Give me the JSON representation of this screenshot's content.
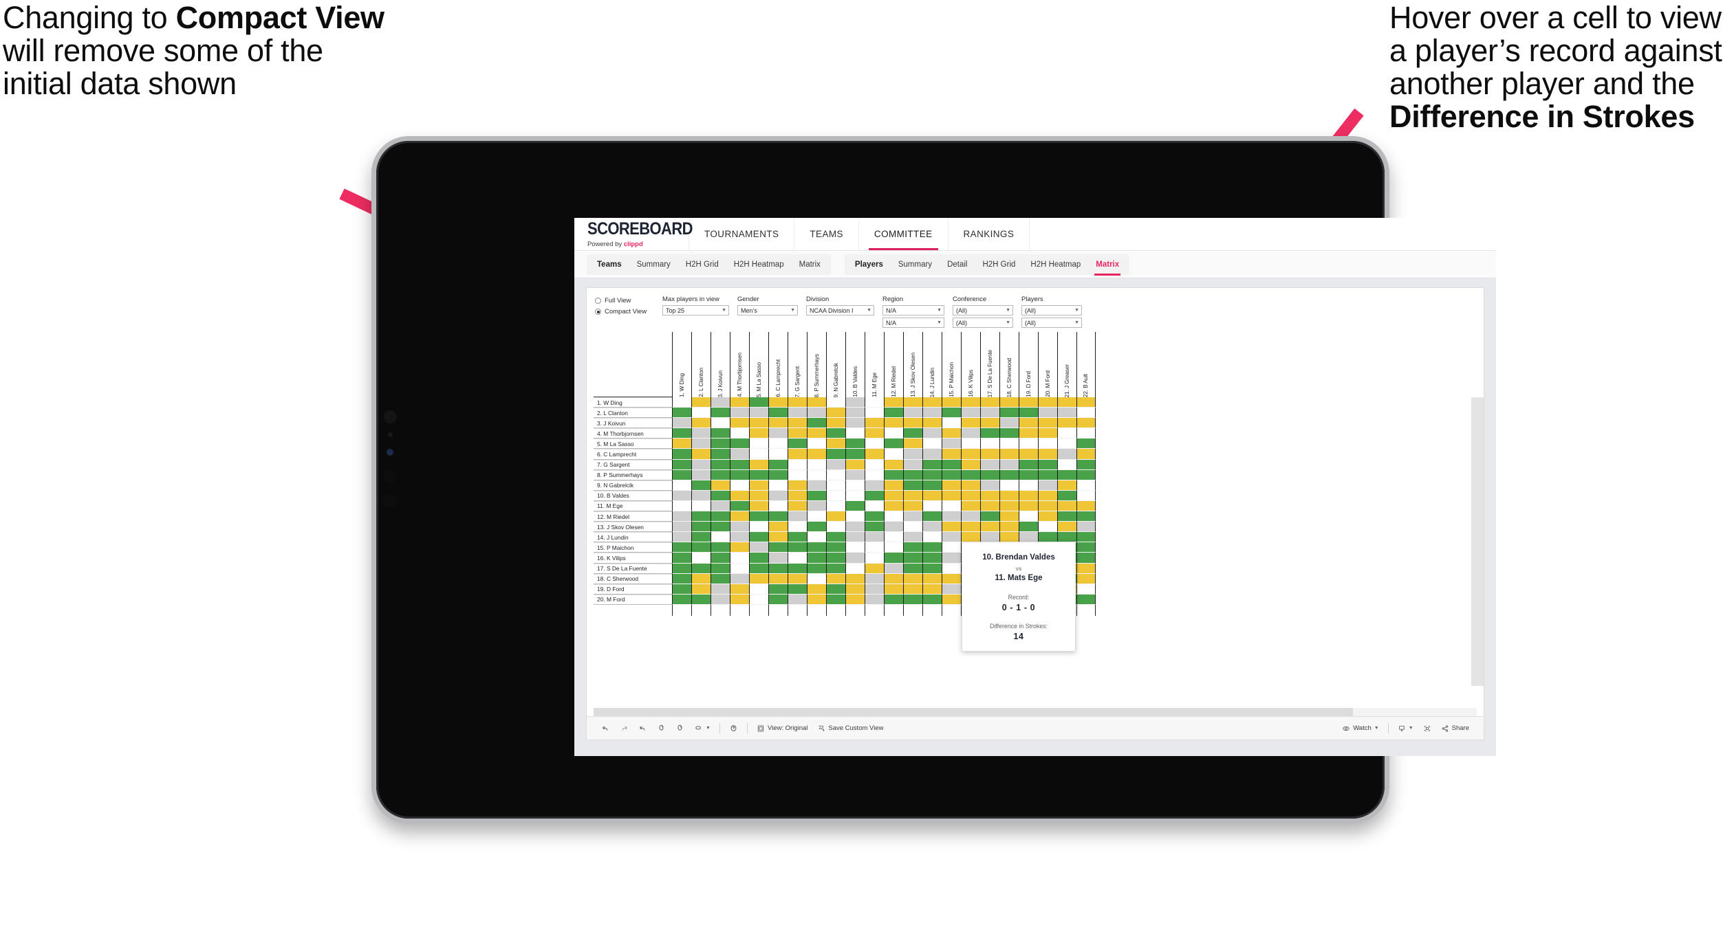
{
  "annotations": {
    "left": {
      "line1": "Changing to ",
      "bold1": "Compact View",
      "line2": " will remove some of the initial data shown"
    },
    "right": {
      "line1": "Hover over a cell to view a player’s record against another player and the ",
      "bold1": "Difference in Strokes"
    }
  },
  "app": {
    "brand": {
      "title": "SCOREBOARD",
      "powered_prefix": "Powered by ",
      "powered_name": "clippd"
    },
    "topnav": [
      {
        "label": "TOURNAMENTS",
        "active": false
      },
      {
        "label": "TEAMS",
        "active": false
      },
      {
        "label": "COMMITTEE",
        "active": true
      },
      {
        "label": "RANKINGS",
        "active": false
      }
    ],
    "subnav": {
      "group_teams": [
        "Teams",
        "Summary",
        "H2H Grid",
        "H2H Heatmap",
        "Matrix"
      ],
      "group_players": [
        "Players",
        "Summary",
        "Detail",
        "H2H Grid",
        "H2H Heatmap",
        "Matrix"
      ],
      "selected": "Matrix"
    },
    "filters": {
      "view_mode": {
        "full": "Full View",
        "compact": "Compact View",
        "selected": "Compact View"
      },
      "fields": [
        {
          "label": "Max players in view",
          "value": "Top 25"
        },
        {
          "label": "Gender",
          "value": "Men’s"
        },
        {
          "label": "Division",
          "value": "NCAA Division I"
        },
        {
          "label": "Region",
          "value": "N/A",
          "value2": "N/A"
        },
        {
          "label": "Conference",
          "value": "(All)",
          "value2": "(All)"
        },
        {
          "label": "Players",
          "value": "(All)",
          "value2": "(All)"
        }
      ]
    },
    "tooltip": {
      "player_a": "10. Brendan Valdes",
      "vs": "vs",
      "player_b": "11. Mats Ege",
      "record_label": "Record:",
      "record_value": "0 - 1 - 0",
      "strokes_label": "Difference in Strokes:",
      "strokes_value": "14"
    },
    "toolbar": {
      "view_label": "View: Original",
      "save_label": "Save Custom View",
      "watch_label": "Watch",
      "share_label": "Share"
    }
  },
  "chart_data": {
    "type": "heatmap",
    "title": "Player Head-to-Head Matrix",
    "legend": {
      "win": "#49a14a",
      "tie": "#eec636",
      "loss": "#cfcfcf",
      "none": "#ffffff"
    },
    "row_labels": [
      "1. W Ding",
      "2. L Clanton",
      "3. J Koivun",
      "4. M Thorbjornsen",
      "5. M La Sasso",
      "6. C Lamprecht",
      "7. G Sargent",
      "8. P Summerhays",
      "9. N Gabrelcik",
      "10. B Valdes",
      "11. M Ege",
      "12. M Riedel",
      "13. J Skov Olesen",
      "14. J Lundin",
      "15. P Maichon",
      "16. K Vilips",
      "17. S De La Fuente",
      "18. C Sherwood",
      "19. D Ford",
      "20. M Ford"
    ],
    "col_labels": [
      "1. W Ding",
      "2. L Clanton",
      "3. J Koivun",
      "4. M Thorbjornsen",
      "5. M La Sasso",
      "6. C Lamprecht",
      "7. G Sargent",
      "8. P Summerhays",
      "9. N Gabrelcik",
      "10. B Valdes",
      "11. M Ege",
      "12. M Riedel",
      "13. J Skov Olesen",
      "14. J Lundin",
      "15. P Maichon",
      "16. K Vilips",
      "17. S De La Fuente",
      "18. C Sherwood",
      "19. D Ford",
      "20. M Ford",
      "21. J Greaser",
      "22. B Ault"
    ],
    "cells": [
      [
        "w",
        "y",
        "a",
        "y",
        "g",
        "y",
        "y",
        "y",
        "w",
        "a",
        "w",
        "y",
        "y",
        "y",
        "y",
        "y",
        "y",
        "y",
        "y",
        "y",
        "y",
        "y"
      ],
      [
        "g",
        "w",
        "g",
        "a",
        "a",
        "g",
        "a",
        "a",
        "y",
        "a",
        "w",
        "g",
        "a",
        "a",
        "g",
        "a",
        "a",
        "g",
        "g",
        "a",
        "a",
        "w"
      ],
      [
        "a",
        "y",
        "w",
        "y",
        "y",
        "y",
        "y",
        "g",
        "y",
        "a",
        "y",
        "y",
        "y",
        "y",
        "w",
        "y",
        "y",
        "a",
        "y",
        "y",
        "y",
        "y"
      ],
      [
        "g",
        "a",
        "g",
        "w",
        "y",
        "a",
        "y",
        "y",
        "g",
        "w",
        "y",
        "w",
        "g",
        "a",
        "y",
        "a",
        "g",
        "g",
        "y",
        "y",
        "w",
        "w"
      ],
      [
        "y",
        "a",
        "g",
        "g",
        "w",
        "w",
        "g",
        "w",
        "y",
        "g",
        "w",
        "g",
        "y",
        "w",
        "a",
        "w",
        "w",
        "w",
        "w",
        "w",
        "w",
        "g"
      ],
      [
        "g",
        "y",
        "g",
        "a",
        "w",
        "w",
        "y",
        "y",
        "g",
        "g",
        "y",
        "w",
        "a",
        "a",
        "y",
        "y",
        "y",
        "y",
        "y",
        "y",
        "a",
        "y"
      ],
      [
        "g",
        "a",
        "g",
        "g",
        "y",
        "g",
        "w",
        "w",
        "a",
        "y",
        "w",
        "y",
        "a",
        "g",
        "g",
        "y",
        "a",
        "a",
        "g",
        "g",
        "w",
        "g"
      ],
      [
        "g",
        "a",
        "g",
        "g",
        "g",
        "g",
        "w",
        "w",
        "w",
        "a",
        "w",
        "g",
        "g",
        "g",
        "g",
        "g",
        "g",
        "g",
        "g",
        "g",
        "g",
        "g"
      ],
      [
        "w",
        "g",
        "y",
        "w",
        "y",
        "w",
        "y",
        "a",
        "w",
        "w",
        "a",
        "y",
        "g",
        "g",
        "y",
        "y",
        "a",
        "w",
        "w",
        "a",
        "y",
        "w"
      ],
      [
        "a",
        "a",
        "g",
        "y",
        "y",
        "a",
        "y",
        "g",
        "w",
        "w",
        "g",
        "y",
        "y",
        "y",
        "y",
        "y",
        "y",
        "y",
        "y",
        "y",
        "g",
        "w"
      ],
      [
        "w",
        "w",
        "a",
        "g",
        "y",
        "w",
        "y",
        "a",
        "w",
        "g",
        "w",
        "y",
        "y",
        "w",
        "w",
        "y",
        "y",
        "y",
        "y",
        "y",
        "y",
        "y"
      ],
      [
        "a",
        "g",
        "g",
        "y",
        "g",
        "g",
        "a",
        "w",
        "y",
        "w",
        "g",
        "w",
        "a",
        "g",
        "a",
        "a",
        "g",
        "y",
        "w",
        "y",
        "g",
        "g"
      ],
      [
        "a",
        "g",
        "g",
        "a",
        "w",
        "y",
        "w",
        "g",
        "w",
        "a",
        "g",
        "a",
        "w",
        "a",
        "y",
        "y",
        "y",
        "y",
        "g",
        "w",
        "y",
        "a"
      ],
      [
        "a",
        "g",
        "w",
        "a",
        "g",
        "y",
        "g",
        "w",
        "g",
        "a",
        "a",
        "w",
        "a",
        "w",
        "a",
        "y",
        "a",
        "y",
        "a",
        "g",
        "g",
        "g"
      ],
      [
        "g",
        "g",
        "g",
        "y",
        "a",
        "g",
        "g",
        "g",
        "g",
        "w",
        "w",
        "w",
        "g",
        "g",
        "w",
        "a",
        "g",
        "g",
        "a",
        "y",
        "g",
        "g"
      ],
      [
        "g",
        "w",
        "g",
        "w",
        "g",
        "a",
        "w",
        "g",
        "g",
        "a",
        "w",
        "g",
        "g",
        "g",
        "a",
        "w",
        "a",
        "g",
        "a",
        "w",
        "g",
        "g"
      ],
      [
        "g",
        "g",
        "g",
        "w",
        "g",
        "g",
        "g",
        "g",
        "g",
        "w",
        "y",
        "a",
        "g",
        "g",
        "w",
        "a",
        "w",
        "g",
        "g",
        "y",
        "y",
        "y"
      ],
      [
        "g",
        "y",
        "g",
        "a",
        "y",
        "y",
        "y",
        "w",
        "y",
        "y",
        "a",
        "y",
        "y",
        "y",
        "y",
        "g",
        "w",
        "w",
        "y",
        "y",
        "g",
        "y"
      ],
      [
        "g",
        "y",
        "a",
        "y",
        "w",
        "g",
        "g",
        "y",
        "g",
        "y",
        "a",
        "y",
        "y",
        "y",
        "a",
        "g",
        "y",
        "g",
        "w",
        "g",
        "y",
        "w"
      ],
      [
        "g",
        "g",
        "a",
        "y",
        "w",
        "g",
        "a",
        "y",
        "g",
        "y",
        "a",
        "g",
        "g",
        "g",
        "y",
        "w",
        "g",
        "g",
        "g",
        "w",
        "g",
        "g"
      ]
    ]
  }
}
